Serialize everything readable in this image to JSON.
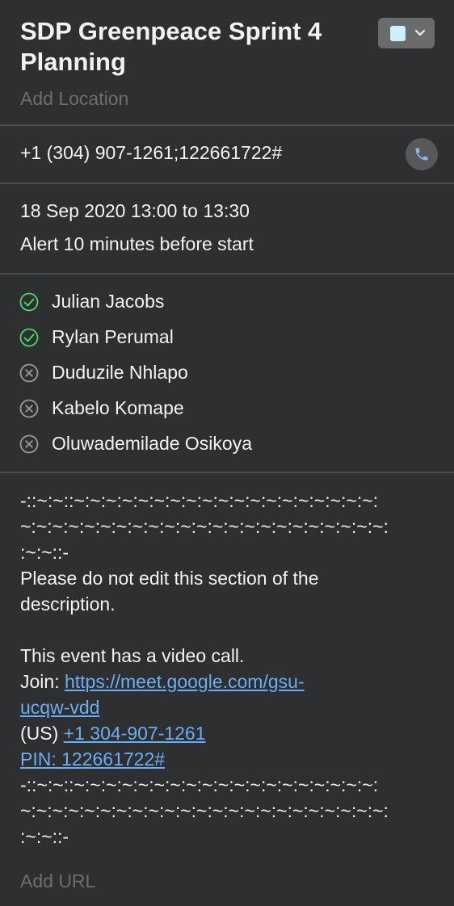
{
  "event": {
    "title_line1": "SDP Greenpeace Sprint 4",
    "title_line2": "Planning",
    "calendar_color": "#c8f3fb",
    "add_location_placeholder": "Add Location"
  },
  "call": {
    "phone_number": "+1 (304) 907-1261;122661722#",
    "phone_icon": "phone-icon"
  },
  "schedule": {
    "date_time": "18 Sep 2020  13:00 to 13:30",
    "alert": "Alert 10 minutes before start"
  },
  "attendees": [
    {
      "name": "Julian Jacobs",
      "status": "accepted"
    },
    {
      "name": "Rylan Perumal",
      "status": "accepted"
    },
    {
      "name": "Duduzile Nhlapo",
      "status": "declined"
    },
    {
      "name": "Kabelo Komape",
      "status": "declined"
    },
    {
      "name": "Oluwademilade Osikoya",
      "status": "declined"
    }
  ],
  "description": {
    "divider_line1": "-::~:~::~:~:~:~:~:~:~:~:~:~:~:~:~:~:~:~:~:~:~:",
    "divider_line2": "~:~:~:~:~:~:~:~:~:~:~:~:~:~:~:~:~:~:~:~:~:~:~:",
    "divider_line3": ":~:~::-",
    "notice_line1": "Please do not edit this section of the",
    "notice_line2": "description.",
    "video_call_text": "This event has a video call.",
    "join_label": "Join: ",
    "join_link_line1": "https://meet.google.com/gsu-",
    "join_link_line2": "ucqw-vdd",
    "us_label": "(US) ",
    "us_phone_link": "+1 304-907-1261",
    "pin_link": "PIN: 122661722#",
    "divider2_line1": "-::~:~::~:~:~:~:~:~:~:~:~:~:~:~:~:~:~:~:~:~:~:",
    "divider2_line2": "~:~:~:~:~:~:~:~:~:~:~:~:~:~:~:~:~:~:~:~:~:~:~:",
    "divider2_line3": ":~:~::-"
  },
  "add_url_placeholder": "Add URL",
  "colors": {
    "background": "#2e2f30",
    "accepted": "#4cd964",
    "declined": "#9a9b9d",
    "link": "#6aaef5",
    "placeholder": "#6d6e70"
  }
}
